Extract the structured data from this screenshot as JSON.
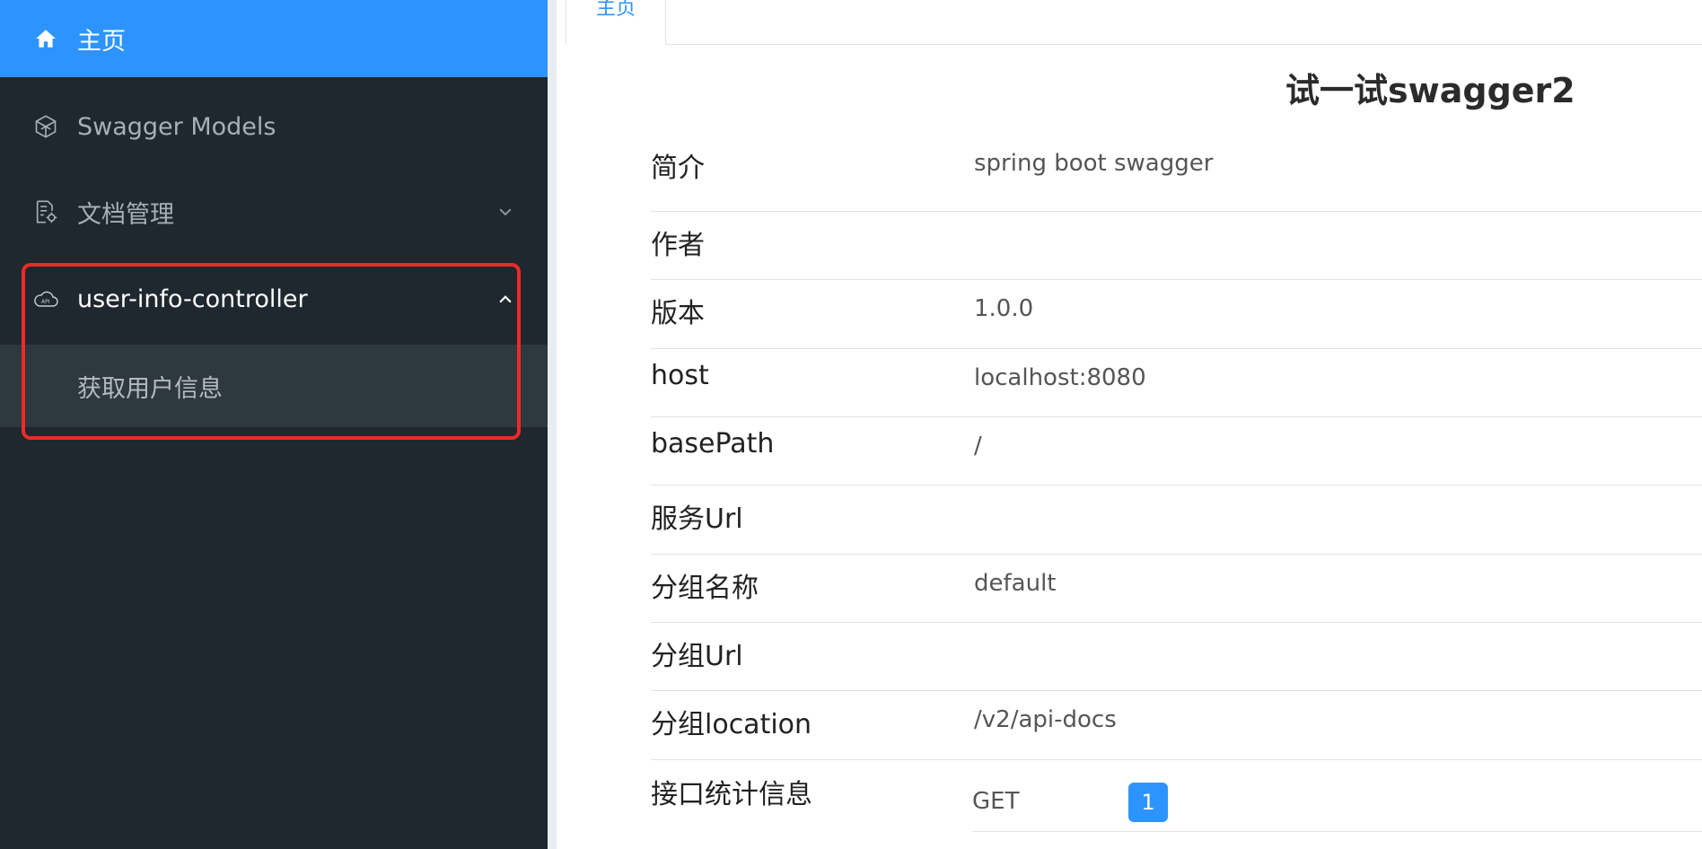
{
  "sidebar": {
    "items": [
      {
        "label": "主页",
        "icon": "home-icon"
      },
      {
        "label": "Swagger Models",
        "icon": "cube-icon"
      },
      {
        "label": "文档管理",
        "icon": "doc-settings-icon"
      },
      {
        "label": "user-info-controller",
        "icon": "cloud-api-icon"
      }
    ],
    "sub_item": {
      "label": "获取用户信息"
    }
  },
  "tabs": [
    {
      "label": "主页"
    }
  ],
  "main": {
    "title": "试一试swagger2",
    "rows": [
      {
        "key": "简介",
        "value": "spring boot swagger"
      },
      {
        "key": "作者",
        "value": ""
      },
      {
        "key": "版本",
        "value": "1.0.0"
      },
      {
        "key": "host",
        "value": "localhost:8080"
      },
      {
        "key": "basePath",
        "value": "/"
      },
      {
        "key": "服务Url",
        "value": ""
      },
      {
        "key": "分组名称",
        "value": "default"
      },
      {
        "key": "分组Url",
        "value": ""
      },
      {
        "key": "分组location",
        "value": "/v2/api-docs"
      },
      {
        "key": "接口统计信息",
        "value": ""
      }
    ],
    "stats": [
      {
        "method": "GET",
        "count": "1"
      }
    ]
  },
  "colors": {
    "accent": "#2d94ff",
    "sidebar_bg": "#1f272f",
    "highlight": "#ee2a26"
  }
}
